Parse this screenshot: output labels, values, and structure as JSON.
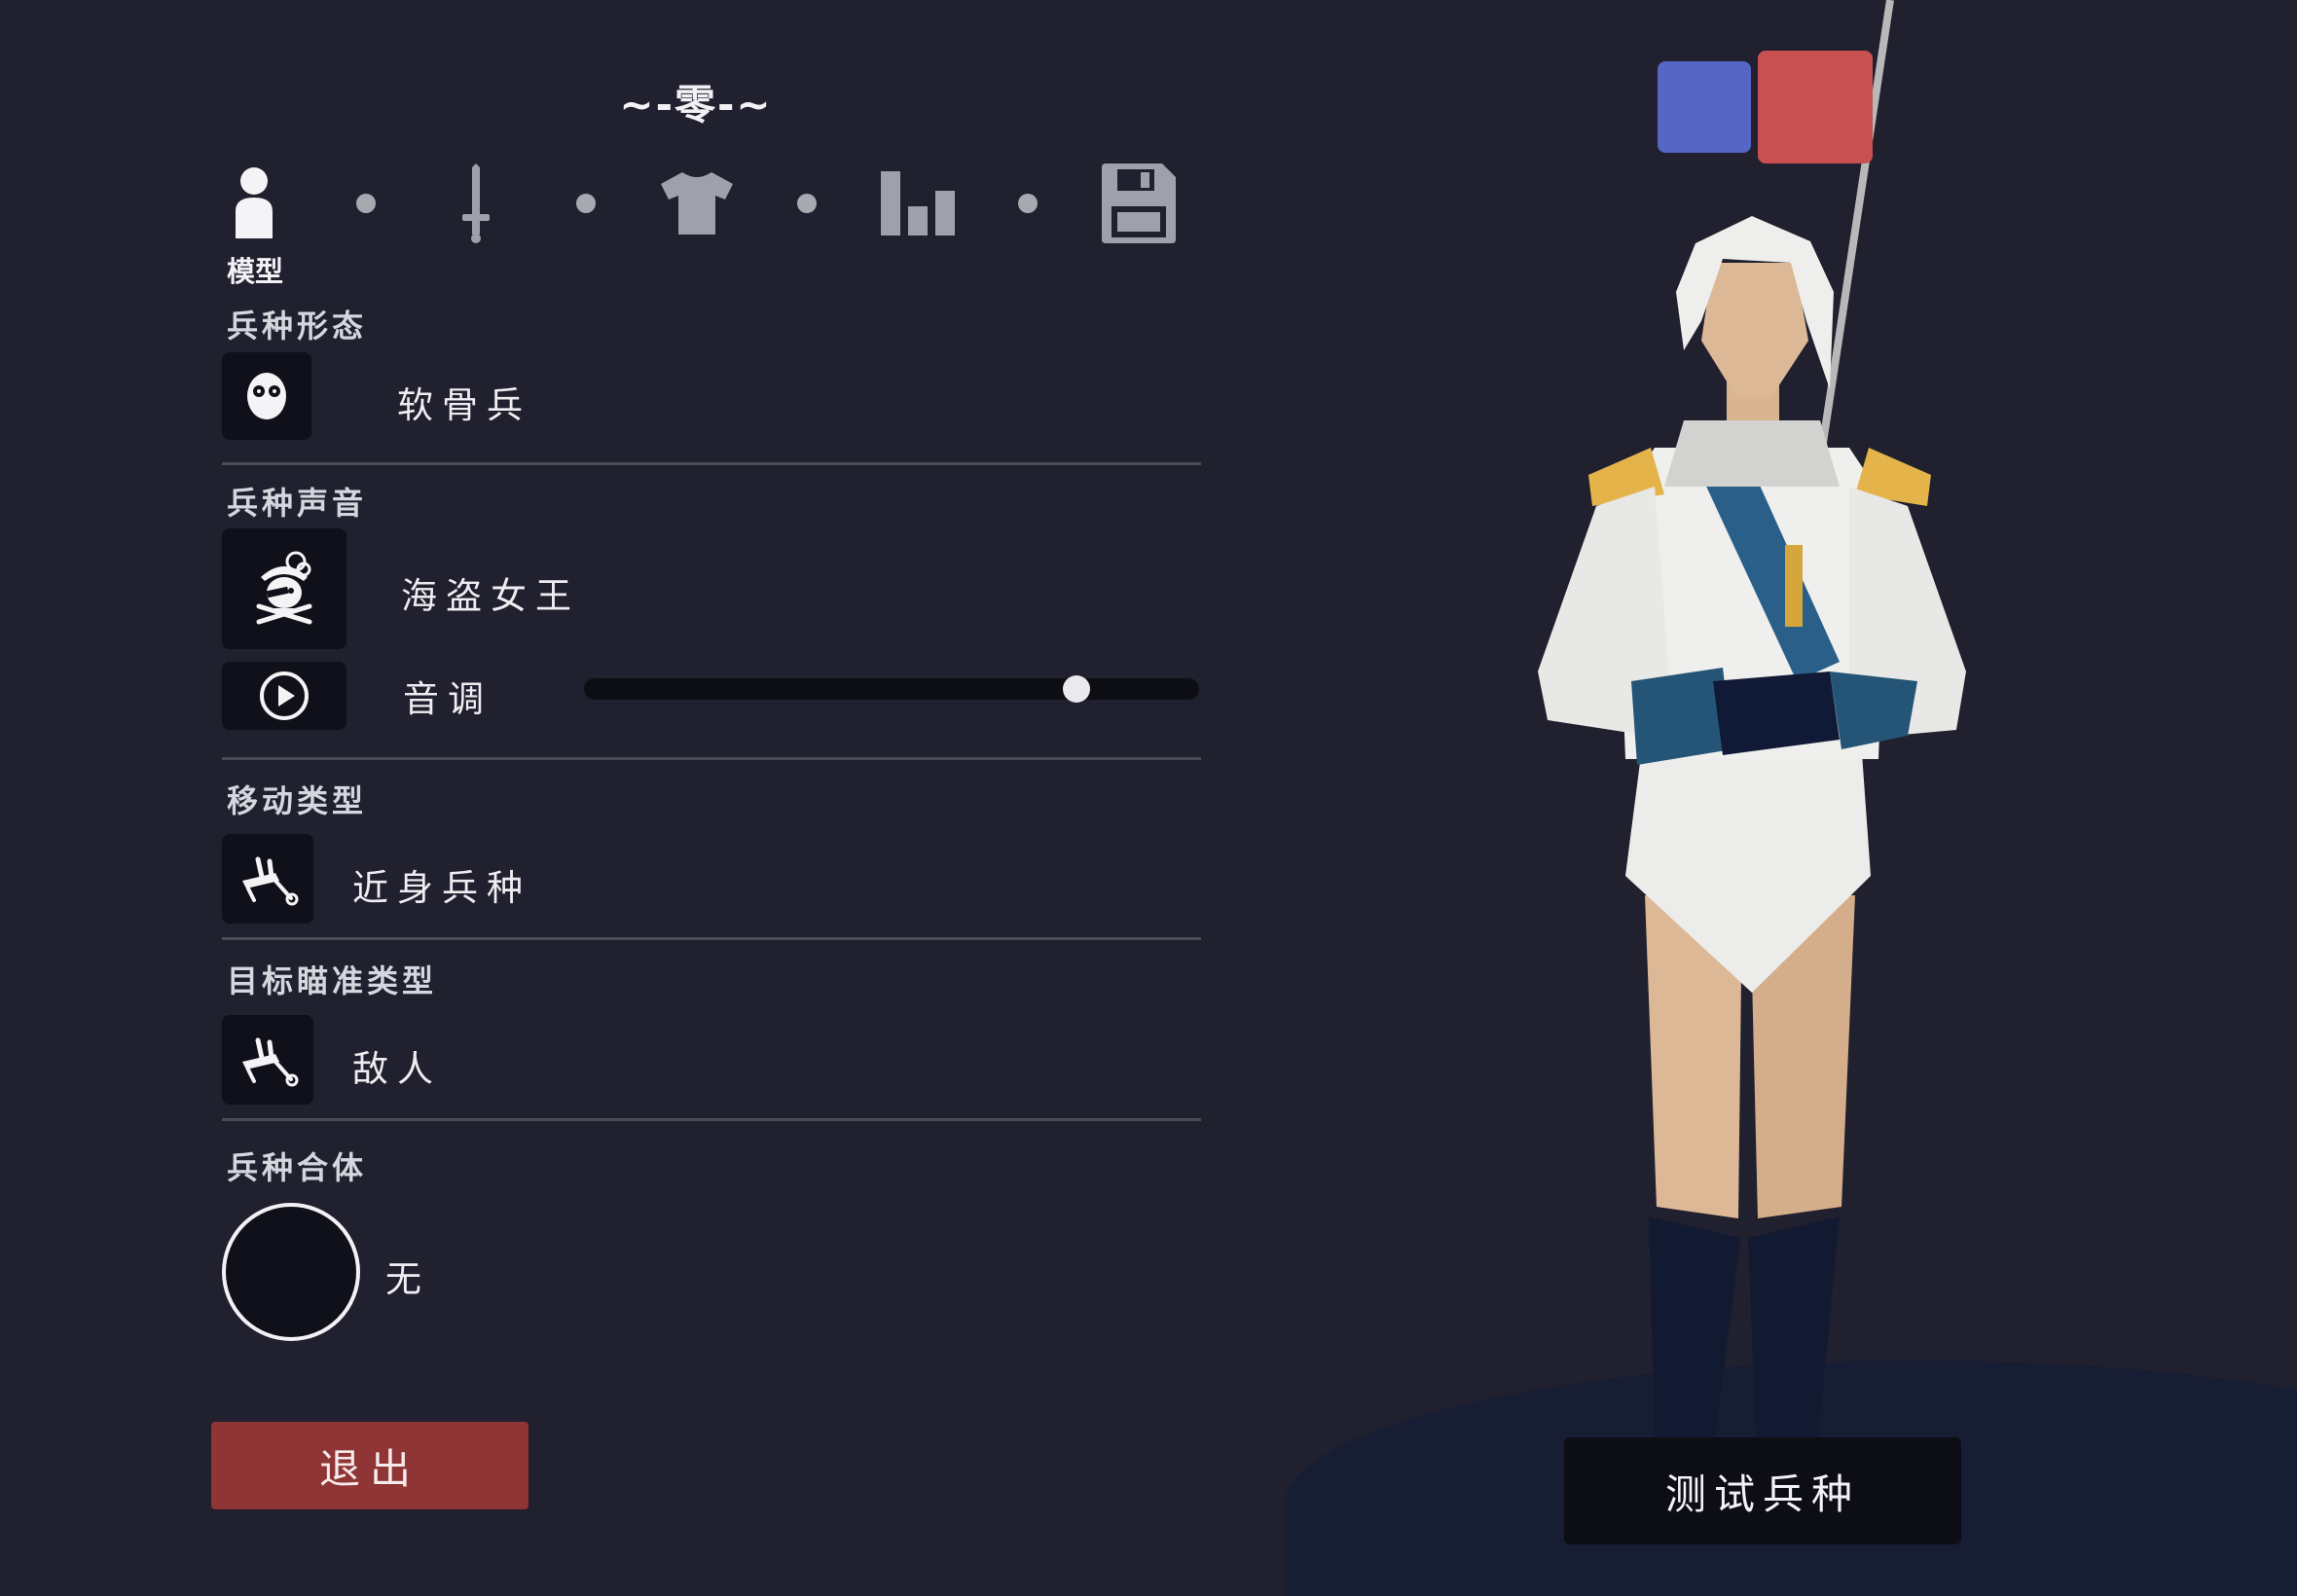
{
  "unit_name": "~-零-~",
  "tabs": [
    {
      "icon": "person-icon",
      "label": "模型",
      "active": true
    },
    {
      "icon": "sword-icon",
      "label": ""
    },
    {
      "icon": "shirt-icon",
      "label": ""
    },
    {
      "icon": "stats-icon",
      "label": ""
    },
    {
      "icon": "save-icon",
      "label": ""
    }
  ],
  "sections": {
    "form": {
      "title": "兵种形态",
      "icon": "ragdoll-face-icon",
      "value": "软骨兵"
    },
    "voice": {
      "title": "兵种声音",
      "icon": "pirate-queen-icon",
      "value": "海盗女王",
      "play_icon": "play-icon",
      "pitch_label": "音调",
      "pitch_level": 0.8
    },
    "movement": {
      "title": "移动类型",
      "icon": "movement-icon",
      "value": "近身兵种"
    },
    "targeting": {
      "title": "目标瞄准类型",
      "icon": "target-icon",
      "value": "敌人"
    },
    "combine": {
      "title": "兵种合体",
      "value": "无"
    }
  },
  "buttons": {
    "exit": "退出",
    "test_unit": "测试兵种"
  },
  "team_colors": {
    "blue": "#5566c4",
    "red": "#c95050"
  },
  "accent_colors": {
    "background": "#20202e",
    "exit_button": "#8f3535",
    "icon_box": "#10101a"
  }
}
